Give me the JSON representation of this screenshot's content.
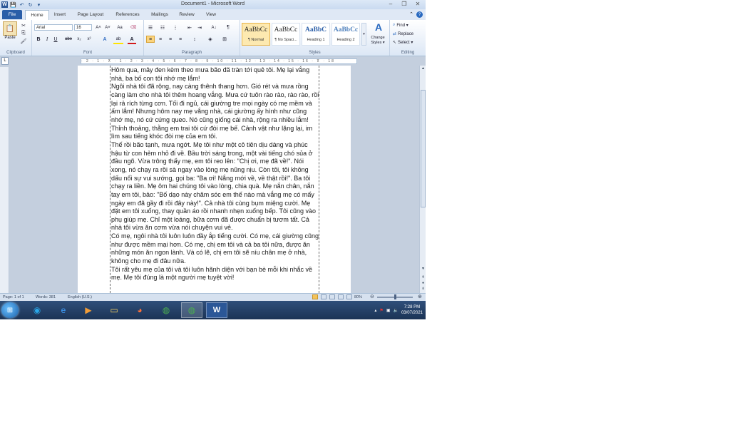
{
  "window": {
    "title": "Document1 - Microsoft Word",
    "controls": {
      "minimize": "–",
      "maximize": "❐",
      "close": "✕"
    }
  },
  "quick_access": {
    "word_logo": "W",
    "save": "💾",
    "undo": "↶",
    "redo": "↻",
    "customize": "▾"
  },
  "tabs": {
    "file": "File",
    "items": [
      "Home",
      "Insert",
      "Page Layout",
      "References",
      "Mailings",
      "Review",
      "View"
    ],
    "active": "Home",
    "right_icons": {
      "minimize_ribbon": "⌃",
      "help": "?"
    }
  },
  "ribbon": {
    "clipboard": {
      "label": "Clipboard",
      "paste": "Paste",
      "cut": "✂",
      "copy": "⎘",
      "format_painter": "🖌"
    },
    "font": {
      "label": "Font",
      "font_name": "Arial",
      "font_size": "16",
      "grow": "A˄",
      "shrink": "A˅",
      "change_case": "Aa",
      "clear": "⌫",
      "bold": "B",
      "italic": "I",
      "underline": "U",
      "strike": "abe",
      "subscript": "x₂",
      "superscript": "x²",
      "text_effects": "A",
      "highlight": "ab",
      "font_color": "A"
    },
    "paragraph": {
      "label": "Paragraph",
      "bullets": "☰",
      "numbering": "☷",
      "multilevel": "⋮",
      "decrease_indent": "⇤",
      "increase_indent": "⇥",
      "sort": "A↓",
      "pilcrow": "¶",
      "align_left": "≡",
      "align_center": "≡",
      "align_right": "≡",
      "justify": "≡",
      "line_spacing": "↕",
      "shading": "◈",
      "borders": "⊞"
    },
    "styles": {
      "label": "Styles",
      "items": [
        {
          "sample": "AaBbCc",
          "name": "¶ Normal",
          "selected": true
        },
        {
          "sample": "AaBbCc",
          "name": "¶ No Spaci...",
          "selected": false
        },
        {
          "sample": "AaBbC",
          "name": "Heading 1",
          "selected": false
        },
        {
          "sample": "AaBbCc",
          "name": "Heading 2",
          "selected": false
        }
      ],
      "change_styles": "Change Styles ▾"
    },
    "editing": {
      "label": "Editing",
      "find": "Find ▾",
      "replace": "Replace",
      "select": "Select ▾"
    }
  },
  "ruler": {
    "marks": "· 2 · 1 · ⊼ · 1 · 2 · 3 · 4 · 5 · 6 · 7 · 8 · 9 · 10 · 11 · 12 · 13 · 14 · 15 · 16 · ⊼ · 18"
  },
  "document": {
    "paragraphs": [
      "Hôm qua, mây đen kèm theo mưa bão đã tràn tới quê tôi. Mẹ lại vắng nhà, ba bố con tôi nhớ mẹ lắm!",
      "Ngôi nhà tôi đã rộng, nay càng thênh thang hơn. Gió rét và mưa rồng càng làm cho nhà tôi thêm hoang vắng. Mưa cứ tuôn rào rào, rào rào, rồi lại rả rích từng cơn. Tối đi ngủ, cái giường tre mọi ngày có mẹ mềm và ấm lắm! Nhưng hôm nay mẹ vắng nhà, cái giường ấy hình như cũng nhớ mẹ, nó cứ cứng queo. Nó cũng giống cái nhà, rộng ra nhiều lắm! Thỉnh thoảng, thằng em trai tôi cứ đòi mẹ bế. Cảnh vật như lặng lại, im lìm sau tiếng khóc đòi mẹ của em tôi.",
      "Thế rồi bão tạnh, mưa ngớt. Mẹ tôi như một cô tiên dịu dàng và phúc hậu từ con hẻm nhỏ đi về. Bầu trời sáng trong, một vài tiếng chó sủa ở đầu ngõ. Vừa trông thấy mẹ, em tôi reo lên: \"Chị ơi, mẹ đã về!\". Nói xong, nó chạy ra rồi sà ngay vào lòng mẹ nũng nịu. Còn tôi, tôi không dấu nổi sự vui sướng, gọi ba: \"Ba ơi! Nắng mới về, về thật rồi!\". Ba tôi chạy ra liền. Mẹ ôm hai chúng tôi vào lòng, chia quà. Mẹ nắn chân, nắn tay em tôi, bảo: \"Bố dạo này chăm sóc em thế nào mà vắng mẹ có mấy ngày em đã gầy đi rồi đây này!\". Cả nhà tôi cùng bụm miệng cười. Mẹ đặt em tôi xuống, thay quần áo rồi nhanh nhẹn xuống bếp. Tôi cũng vào phụ giúp mẹ. Chỉ một loáng, bữa cơm đã được chuẩn bị tươm tất. Cả nhà tôi vừa ăn cơm vừa nói chuyện vui vẻ.",
      "Có mẹ, ngôi nhà tôi luôn luôn đầy ắp tiếng cười. Có mẹ, cái giường cũng như được mềm mại hơn. Có mẹ, chị em tôi và cả ba tôi nữa, được ăn những món ăn ngon lành. Và có lẽ, chị em tôi sẽ níu chân mẹ ở nhà, không cho mẹ đi đâu nữa.",
      "Tôi rất yêu mẹ của tôi và tôi luôn hãnh diện với bạn bè mỗi khi nhắc về mẹ. Mẹ tôi đúng là một người mẹ tuyệt vời!"
    ]
  },
  "statusbar": {
    "page": "Page: 1 of 1",
    "words": "Words: 381",
    "language": "English (U.S.)",
    "zoom": "80%",
    "zoom_level": 0.5
  },
  "taskbar": {
    "start": "⊞",
    "apps": [
      {
        "name": "skype",
        "glyph": "◉",
        "color": "#2aa7e8"
      },
      {
        "name": "internet-explorer",
        "glyph": "e",
        "color": "#3fa0ff"
      },
      {
        "name": "media-player",
        "glyph": "▶",
        "color": "#f29d38"
      },
      {
        "name": "file-explorer",
        "glyph": "▭",
        "color": "#f2cf63"
      },
      {
        "name": "firefox",
        "glyph": "◕",
        "color": "#ff7139"
      },
      {
        "name": "chrome",
        "glyph": "◍",
        "color": "#4caf50"
      },
      {
        "name": "chrome-profile",
        "glyph": "◍",
        "color": "#4caf50"
      },
      {
        "name": "word",
        "glyph": "W",
        "color": "#2b5797"
      }
    ],
    "tray": {
      "arrow": "▴",
      "flag": "⚑",
      "network": "▣",
      "volume": "🔈"
    },
    "clock": {
      "time": "7:28 PM",
      "date": "03/07/2021"
    }
  }
}
